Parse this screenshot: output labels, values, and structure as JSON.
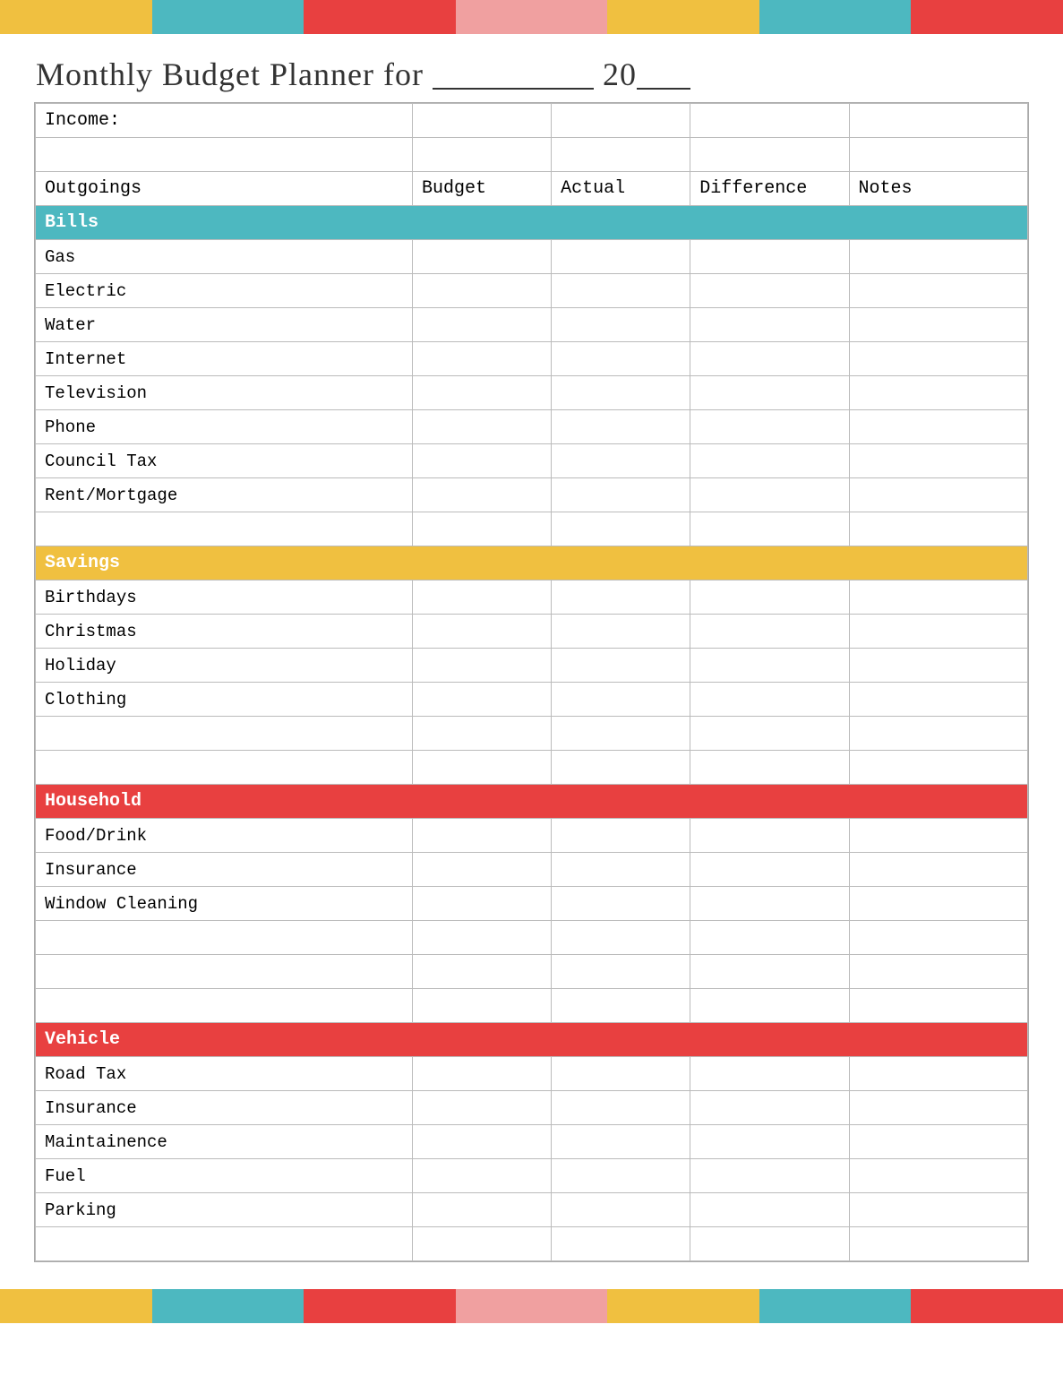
{
  "title": {
    "text": "Monthly Budget Planner for",
    "blank_line": "___________",
    "year_prefix": "20",
    "year_blank": "__"
  },
  "top_banner": [
    {
      "color": "#f0c040"
    },
    {
      "color": "#4db8c0"
    },
    {
      "color": "#e84040"
    },
    {
      "color": "#f0a0a0"
    },
    {
      "color": "#f0c040"
    },
    {
      "color": "#4db8c0"
    },
    {
      "color": "#e84040"
    }
  ],
  "bottom_banner": [
    {
      "color": "#f0c040"
    },
    {
      "color": "#4db8c0"
    },
    {
      "color": "#e84040"
    },
    {
      "color": "#f0a0a0"
    },
    {
      "color": "#f0c040"
    },
    {
      "color": "#4db8c0"
    },
    {
      "color": "#e84040"
    }
  ],
  "table": {
    "income_label": "Income:",
    "headers": {
      "outgoings": "Outgoings",
      "budget": "Budget",
      "actual": "Actual",
      "difference": "Difference",
      "notes": "Notes"
    },
    "sections": [
      {
        "name": "bills",
        "label": "Bills",
        "color": "bills-header",
        "rows": [
          "Gas",
          "Electric",
          "Water",
          "Internet",
          "Television",
          "Phone",
          "Council Tax",
          "Rent/Mortgage"
        ]
      },
      {
        "name": "savings",
        "label": "Savings",
        "color": "savings-header",
        "rows": [
          "Birthdays",
          "Christmas",
          "Holiday",
          "Clothing"
        ]
      },
      {
        "name": "household",
        "label": "Household",
        "color": "household-header",
        "rows": [
          "Food/Drink",
          "Insurance",
          "Window Cleaning"
        ]
      },
      {
        "name": "vehicle",
        "label": "Vehicle",
        "color": "vehicle-header",
        "rows": [
          "Road Tax",
          "Insurance",
          "Maintainence",
          "Fuel",
          "Parking"
        ]
      }
    ]
  }
}
